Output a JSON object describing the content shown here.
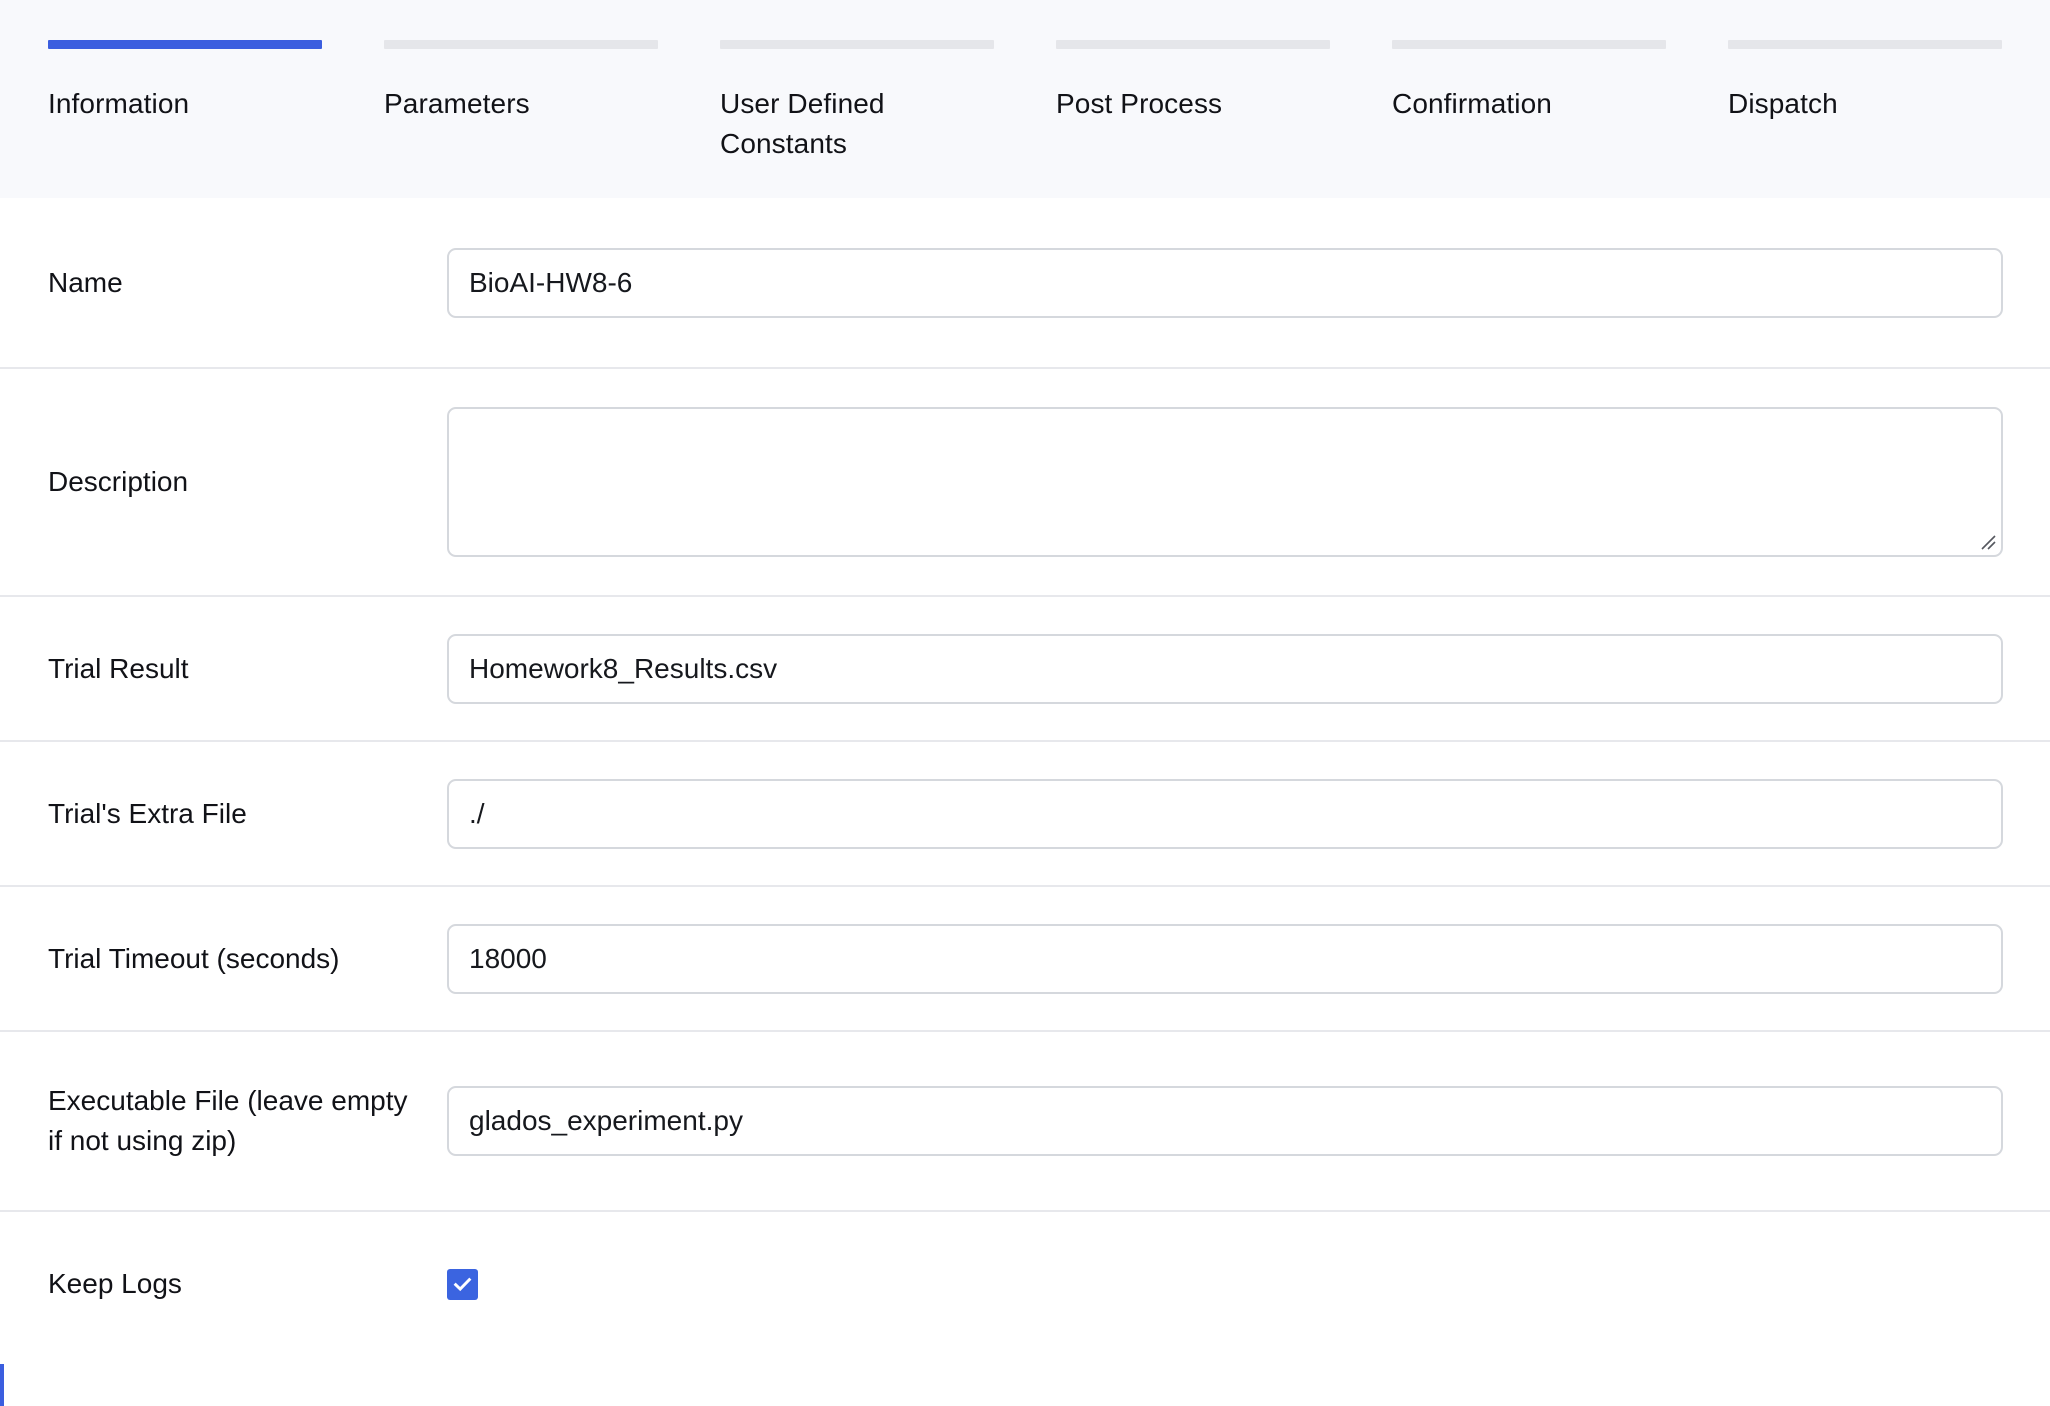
{
  "colors": {
    "accent": "#3B5EDF",
    "accent_checkbox": "#3B64E0",
    "step_bar_inactive": "#E5E6EA",
    "header_bg": "#F8F9FC",
    "divider": "#E7E8EC",
    "input_border": "#D5D8DD",
    "text": "#111217"
  },
  "stepper": {
    "steps": [
      {
        "label": "Information",
        "active": true
      },
      {
        "label": "Parameters",
        "active": false
      },
      {
        "label": "User Defined Constants",
        "active": false
      },
      {
        "label": "Post Process",
        "active": false
      },
      {
        "label": "Confirmation",
        "active": false
      },
      {
        "label": "Dispatch",
        "active": false
      }
    ]
  },
  "form": {
    "fields": {
      "name": {
        "label": "Name",
        "value": "BioAI-HW8-6",
        "placeholder": ""
      },
      "description": {
        "label": "Description",
        "value": "",
        "placeholder": ""
      },
      "trial_result": {
        "label": "Trial Result",
        "value": "Homework8_Results.csv",
        "placeholder": ""
      },
      "trial_extra_file": {
        "label": "Trial's Extra File",
        "value": "./",
        "placeholder": ""
      },
      "trial_timeout": {
        "label": "Trial Timeout (seconds)",
        "value": "18000",
        "placeholder": ""
      },
      "executable_file": {
        "label": "Executable File (leave empty if not using zip)",
        "value": "glados_experiment.py",
        "placeholder": ""
      },
      "keep_logs": {
        "label": "Keep Logs",
        "checked": true,
        "icon": "check-icon"
      }
    }
  },
  "icons": {
    "resize_grip": "resize-grip-icon",
    "check": "check-icon"
  }
}
